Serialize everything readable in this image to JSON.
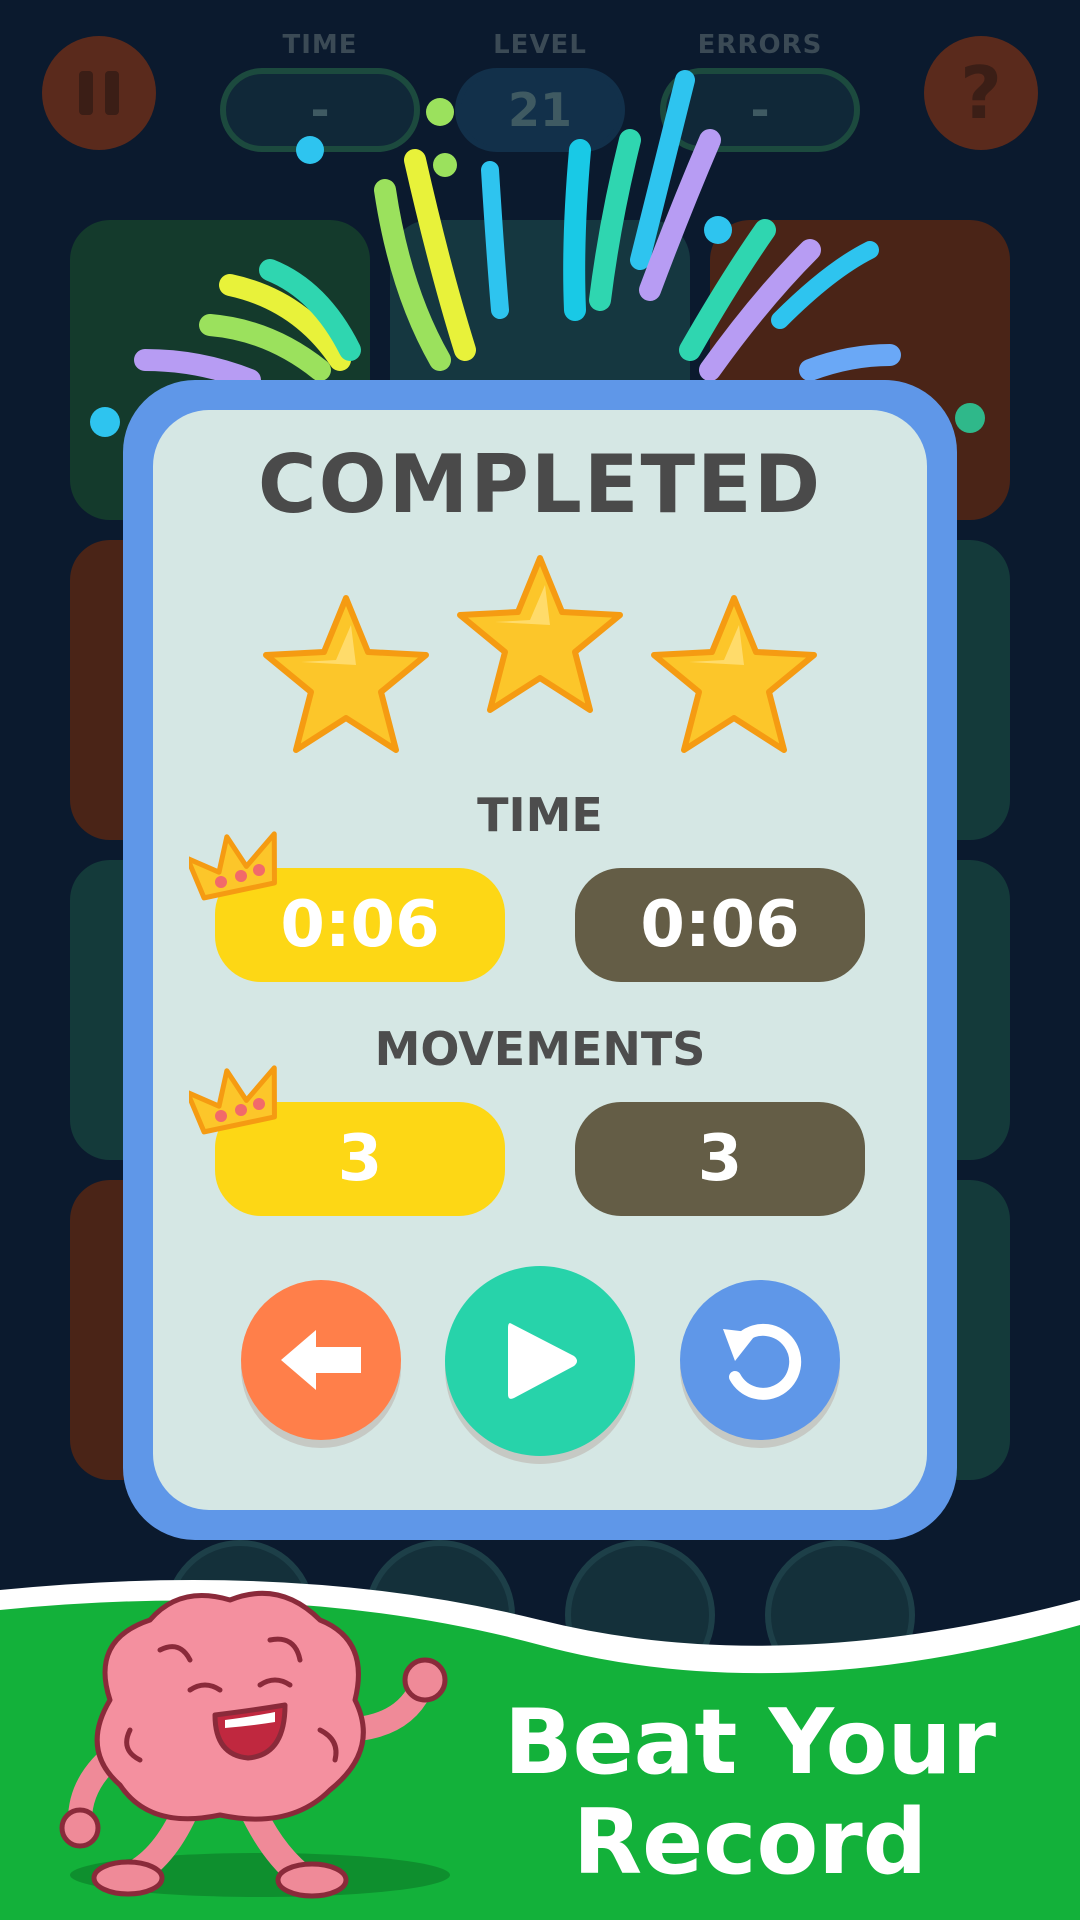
{
  "hud": {
    "time_label": "TIME",
    "time_value": "-",
    "level_label": "LEVEL",
    "level_value": "21",
    "errors_label": "ERRORS",
    "errors_value": "-",
    "pause_icon": "pause-icon",
    "help_label": "?"
  },
  "dialog": {
    "title": "COMPLETED",
    "stars_earned": 3,
    "stars_total": 3,
    "time": {
      "label": "TIME",
      "best": "0:06",
      "current": "0:06"
    },
    "movements": {
      "label": "MOVEMENTS",
      "best": "3",
      "current": "3"
    },
    "buttons": {
      "back_icon": "arrow-left-icon",
      "next_icon": "play-icon",
      "retry_icon": "restart-icon"
    }
  },
  "banner": {
    "line1": "Beat Your",
    "line2": "Record"
  },
  "colors": {
    "dialog_border": "#5f97e8",
    "dialog_fill": "#d5e7e4",
    "best_pill": "#fdd715",
    "current_pill": "#645d46",
    "back_button": "#ff7f4a",
    "next_button": "#27d3aa",
    "retry_button": "#5f97e8",
    "banner_green": "#13b13a"
  }
}
